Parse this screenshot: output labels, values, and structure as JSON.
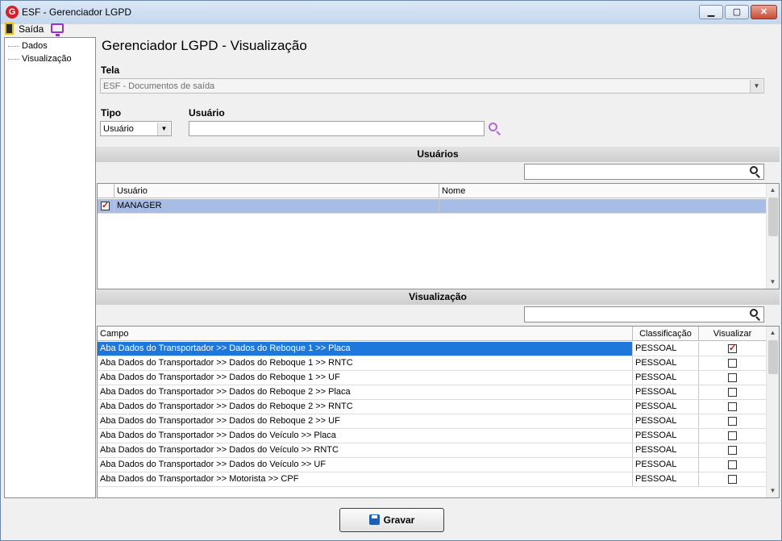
{
  "window": {
    "title": "ESF - Gerenciador LGPD",
    "min_label": "▁",
    "max_label": "▢",
    "close_label": "✕"
  },
  "menu": {
    "exit_label": "Saída"
  },
  "tree": {
    "items": [
      {
        "label": "Dados"
      },
      {
        "label": "Visualização"
      }
    ]
  },
  "page": {
    "title": "Gerenciador LGPD - Visualização"
  },
  "form": {
    "tela_label": "Tela",
    "tela_value": "ESF - Documentos de saída",
    "tipo_label": "Tipo",
    "tipo_value": "Usuário",
    "usuario_label": "Usuário",
    "usuario_value": ""
  },
  "users_section": {
    "title": "Usuários",
    "filter_value": "",
    "columns": [
      "Usuário",
      "Nome"
    ],
    "rows": [
      {
        "checked": true,
        "usuario": "MANAGER",
        "nome": ""
      }
    ]
  },
  "view_section": {
    "title": "Visualização",
    "filter_value": "",
    "columns": [
      "Campo",
      "Classificação",
      "Visualizar"
    ],
    "rows": [
      {
        "campo": "Aba Dados do Transportador >> Dados do Reboque 1 >> Placa",
        "classificacao": "PESSOAL",
        "visualizar": true
      },
      {
        "campo": "Aba Dados do Transportador >> Dados do Reboque 1 >> RNTC",
        "classificacao": "PESSOAL",
        "visualizar": false
      },
      {
        "campo": "Aba Dados do Transportador >> Dados do Reboque 1 >> UF",
        "classificacao": "PESSOAL",
        "visualizar": false
      },
      {
        "campo": "Aba Dados do Transportador >> Dados do Reboque 2 >> Placa",
        "classificacao": "PESSOAL",
        "visualizar": false
      },
      {
        "campo": "Aba Dados do Transportador >> Dados do Reboque 2 >> RNTC",
        "classificacao": "PESSOAL",
        "visualizar": false
      },
      {
        "campo": "Aba Dados do Transportador >> Dados do Reboque 2 >> UF",
        "classificacao": "PESSOAL",
        "visualizar": false
      },
      {
        "campo": "Aba Dados do Transportador >> Dados do Veículo >> Placa",
        "classificacao": "PESSOAL",
        "visualizar": false
      },
      {
        "campo": "Aba Dados do Transportador >> Dados do Veículo >> RNTC",
        "classificacao": "PESSOAL",
        "visualizar": false
      },
      {
        "campo": "Aba Dados do Transportador >> Dados do Veículo >> UF",
        "classificacao": "PESSOAL",
        "visualizar": false
      },
      {
        "campo": "Aba Dados do Transportador >> Motorista >> CPF",
        "classificacao": "PESSOAL",
        "visualizar": false
      }
    ]
  },
  "actions": {
    "save_label": "Gravar"
  },
  "colors": {
    "selected_row": "#1e78dc",
    "selected_user_row": "#a8bde6",
    "check_mark": "#d01010",
    "title_bar": "#c4d7ee"
  }
}
